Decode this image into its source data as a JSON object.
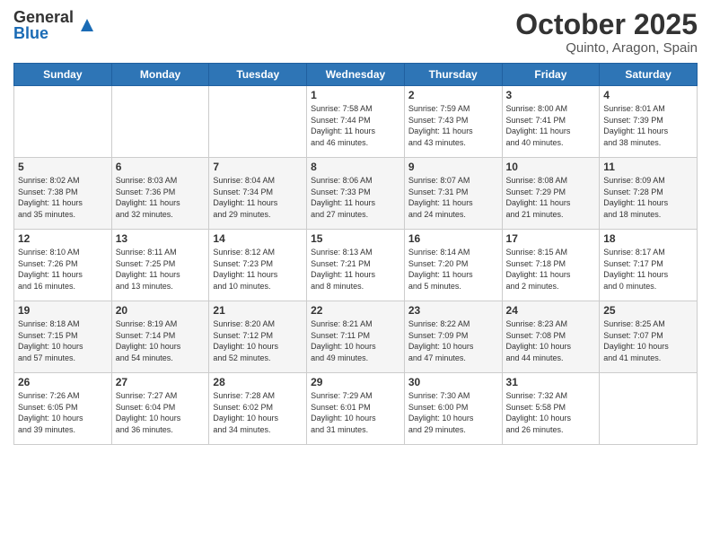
{
  "header": {
    "logo_general": "General",
    "logo_blue": "Blue",
    "month_title": "October 2025",
    "location": "Quinto, Aragon, Spain"
  },
  "weekdays": [
    "Sunday",
    "Monday",
    "Tuesday",
    "Wednesday",
    "Thursday",
    "Friday",
    "Saturday"
  ],
  "weeks": [
    [
      {
        "day": "",
        "info": ""
      },
      {
        "day": "",
        "info": ""
      },
      {
        "day": "",
        "info": ""
      },
      {
        "day": "1",
        "info": "Sunrise: 7:58 AM\nSunset: 7:44 PM\nDaylight: 11 hours\nand 46 minutes."
      },
      {
        "day": "2",
        "info": "Sunrise: 7:59 AM\nSunset: 7:43 PM\nDaylight: 11 hours\nand 43 minutes."
      },
      {
        "day": "3",
        "info": "Sunrise: 8:00 AM\nSunset: 7:41 PM\nDaylight: 11 hours\nand 40 minutes."
      },
      {
        "day": "4",
        "info": "Sunrise: 8:01 AM\nSunset: 7:39 PM\nDaylight: 11 hours\nand 38 minutes."
      }
    ],
    [
      {
        "day": "5",
        "info": "Sunrise: 8:02 AM\nSunset: 7:38 PM\nDaylight: 11 hours\nand 35 minutes."
      },
      {
        "day": "6",
        "info": "Sunrise: 8:03 AM\nSunset: 7:36 PM\nDaylight: 11 hours\nand 32 minutes."
      },
      {
        "day": "7",
        "info": "Sunrise: 8:04 AM\nSunset: 7:34 PM\nDaylight: 11 hours\nand 29 minutes."
      },
      {
        "day": "8",
        "info": "Sunrise: 8:06 AM\nSunset: 7:33 PM\nDaylight: 11 hours\nand 27 minutes."
      },
      {
        "day": "9",
        "info": "Sunrise: 8:07 AM\nSunset: 7:31 PM\nDaylight: 11 hours\nand 24 minutes."
      },
      {
        "day": "10",
        "info": "Sunrise: 8:08 AM\nSunset: 7:29 PM\nDaylight: 11 hours\nand 21 minutes."
      },
      {
        "day": "11",
        "info": "Sunrise: 8:09 AM\nSunset: 7:28 PM\nDaylight: 11 hours\nand 18 minutes."
      }
    ],
    [
      {
        "day": "12",
        "info": "Sunrise: 8:10 AM\nSunset: 7:26 PM\nDaylight: 11 hours\nand 16 minutes."
      },
      {
        "day": "13",
        "info": "Sunrise: 8:11 AM\nSunset: 7:25 PM\nDaylight: 11 hours\nand 13 minutes."
      },
      {
        "day": "14",
        "info": "Sunrise: 8:12 AM\nSunset: 7:23 PM\nDaylight: 11 hours\nand 10 minutes."
      },
      {
        "day": "15",
        "info": "Sunrise: 8:13 AM\nSunset: 7:21 PM\nDaylight: 11 hours\nand 8 minutes."
      },
      {
        "day": "16",
        "info": "Sunrise: 8:14 AM\nSunset: 7:20 PM\nDaylight: 11 hours\nand 5 minutes."
      },
      {
        "day": "17",
        "info": "Sunrise: 8:15 AM\nSunset: 7:18 PM\nDaylight: 11 hours\nand 2 minutes."
      },
      {
        "day": "18",
        "info": "Sunrise: 8:17 AM\nSunset: 7:17 PM\nDaylight: 11 hours\nand 0 minutes."
      }
    ],
    [
      {
        "day": "19",
        "info": "Sunrise: 8:18 AM\nSunset: 7:15 PM\nDaylight: 10 hours\nand 57 minutes."
      },
      {
        "day": "20",
        "info": "Sunrise: 8:19 AM\nSunset: 7:14 PM\nDaylight: 10 hours\nand 54 minutes."
      },
      {
        "day": "21",
        "info": "Sunrise: 8:20 AM\nSunset: 7:12 PM\nDaylight: 10 hours\nand 52 minutes."
      },
      {
        "day": "22",
        "info": "Sunrise: 8:21 AM\nSunset: 7:11 PM\nDaylight: 10 hours\nand 49 minutes."
      },
      {
        "day": "23",
        "info": "Sunrise: 8:22 AM\nSunset: 7:09 PM\nDaylight: 10 hours\nand 47 minutes."
      },
      {
        "day": "24",
        "info": "Sunrise: 8:23 AM\nSunset: 7:08 PM\nDaylight: 10 hours\nand 44 minutes."
      },
      {
        "day": "25",
        "info": "Sunrise: 8:25 AM\nSunset: 7:07 PM\nDaylight: 10 hours\nand 41 minutes."
      }
    ],
    [
      {
        "day": "26",
        "info": "Sunrise: 7:26 AM\nSunset: 6:05 PM\nDaylight: 10 hours\nand 39 minutes."
      },
      {
        "day": "27",
        "info": "Sunrise: 7:27 AM\nSunset: 6:04 PM\nDaylight: 10 hours\nand 36 minutes."
      },
      {
        "day": "28",
        "info": "Sunrise: 7:28 AM\nSunset: 6:02 PM\nDaylight: 10 hours\nand 34 minutes."
      },
      {
        "day": "29",
        "info": "Sunrise: 7:29 AM\nSunset: 6:01 PM\nDaylight: 10 hours\nand 31 minutes."
      },
      {
        "day": "30",
        "info": "Sunrise: 7:30 AM\nSunset: 6:00 PM\nDaylight: 10 hours\nand 29 minutes."
      },
      {
        "day": "31",
        "info": "Sunrise: 7:32 AM\nSunset: 5:58 PM\nDaylight: 10 hours\nand 26 minutes."
      },
      {
        "day": "",
        "info": ""
      }
    ]
  ]
}
